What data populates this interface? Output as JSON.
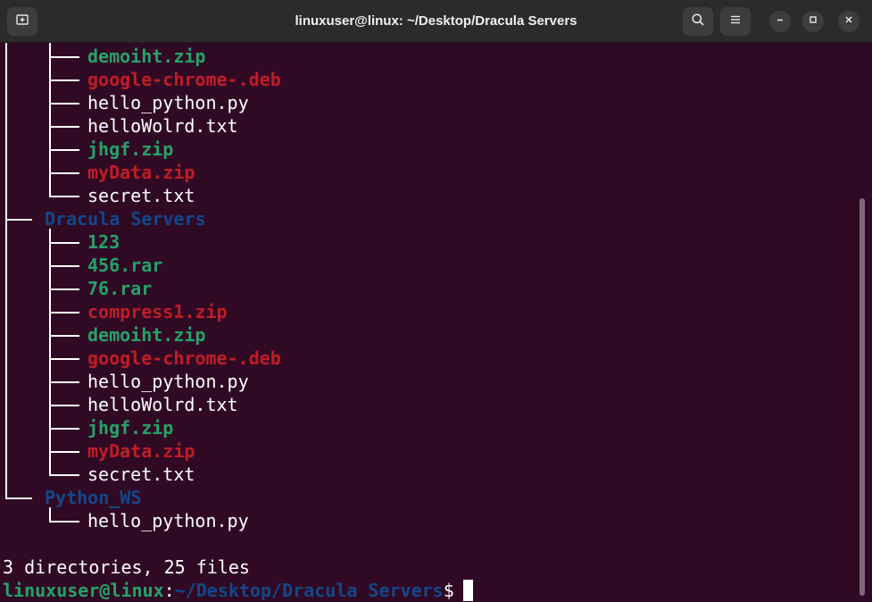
{
  "window": {
    "title": "linuxuser@linux: ~/Desktop/Dracula Servers",
    "colors": {
      "background": "#300a24",
      "titlebar": "#2b2b2b",
      "green": "#26a269",
      "red": "#c01c28",
      "blue": "#12488b",
      "white": "#ffffff"
    }
  },
  "titlebar": {
    "new_tab_icon": "new-tab-icon",
    "search_icon": "search-icon",
    "menu_icon": "hamburger-menu-icon",
    "minimize_icon": "minimize-icon",
    "maximize_icon": "maximize-icon",
    "close_icon": "close-icon"
  },
  "tree": {
    "group1_files": [
      {
        "name": "demoiht.zip",
        "color": "green"
      },
      {
        "name": "google-chrome-.deb",
        "color": "red"
      },
      {
        "name": "hello_python.py",
        "color": "white"
      },
      {
        "name": "helloWolrd.txt",
        "color": "white"
      },
      {
        "name": "jhgf.zip",
        "color": "green"
      },
      {
        "name": "myData.zip",
        "color": "red"
      },
      {
        "name": "secret.txt",
        "color": "white"
      }
    ],
    "dir2": {
      "name": "Dracula Servers",
      "color": "blue"
    },
    "group2_files": [
      {
        "name": "123",
        "color": "green"
      },
      {
        "name": "456.rar",
        "color": "green"
      },
      {
        "name": "76.rar",
        "color": "green"
      },
      {
        "name": "compress1.zip",
        "color": "red"
      },
      {
        "name": "demoiht.zip",
        "color": "green"
      },
      {
        "name": "google-chrome-.deb",
        "color": "red"
      },
      {
        "name": "hello_python.py",
        "color": "white"
      },
      {
        "name": "helloWolrd.txt",
        "color": "white"
      },
      {
        "name": "jhgf.zip",
        "color": "green"
      },
      {
        "name": "myData.zip",
        "color": "red"
      },
      {
        "name": "secret.txt",
        "color": "white"
      }
    ],
    "dir3": {
      "name": "Python_WS",
      "color": "blue"
    },
    "group3_files": [
      {
        "name": "hello_python.py",
        "color": "white"
      }
    ]
  },
  "summary": "3 directories, 25 files",
  "prompt": {
    "user": "linuxuser@linux",
    "separator": ":",
    "path": "~/Desktop/Dracula Servers",
    "symbol": "$"
  }
}
